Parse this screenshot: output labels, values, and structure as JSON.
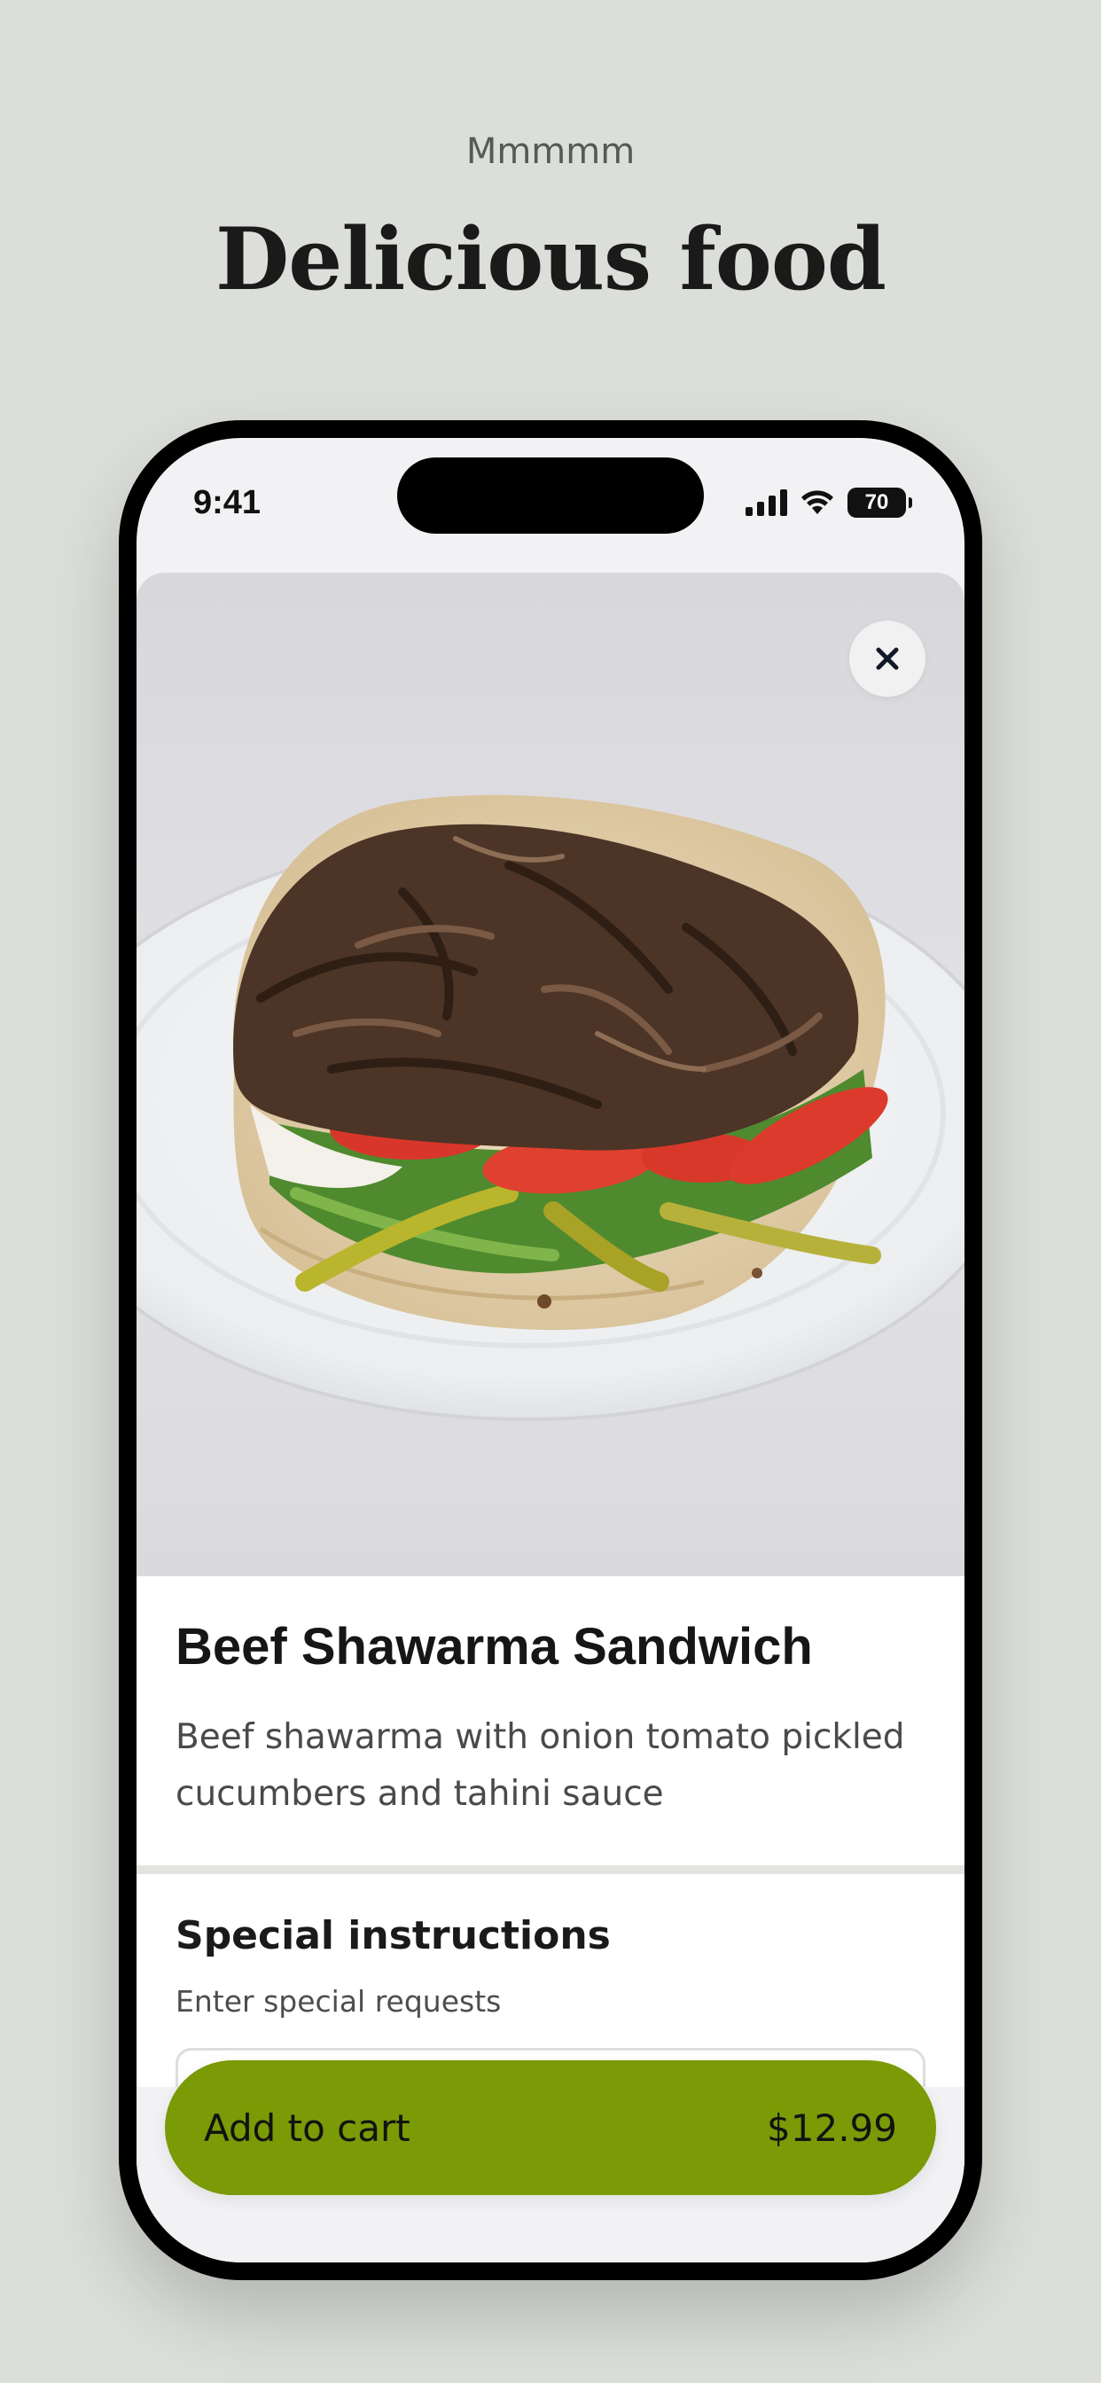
{
  "page": {
    "eyebrow": "Mmmmm",
    "headline": "Delicious food"
  },
  "status_bar": {
    "time": "9:41",
    "battery": "70",
    "icons": [
      "signal-icon",
      "wifi-icon",
      "battery-icon"
    ]
  },
  "product": {
    "image_icon": "shawarma-photo",
    "close_icon": "close-icon",
    "title": "Beef Shawarma Sandwich",
    "description": "Beef shawarma with onion tomato pickled cucumbers and tahini sauce"
  },
  "instructions": {
    "title": "Special instructions",
    "subtitle": "Enter special requests",
    "value": ""
  },
  "cart_button": {
    "label": "Add to cart",
    "price": "$12.99",
    "color": "#7a9a06"
  }
}
